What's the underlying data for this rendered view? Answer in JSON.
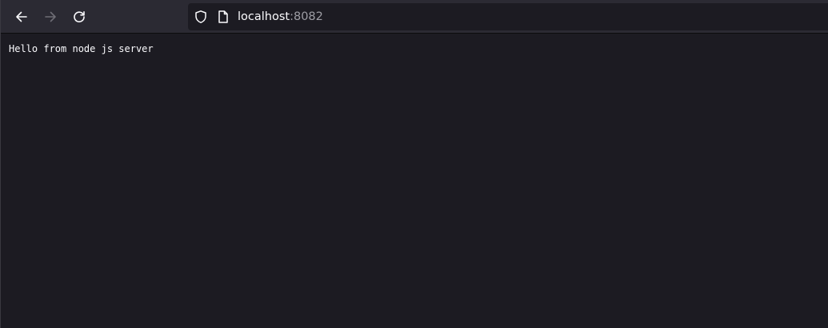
{
  "toolbar": {
    "back_icon": "arrow-left-icon",
    "forward_icon": "arrow-right-icon",
    "reload_icon": "reload-icon"
  },
  "urlbar": {
    "security_icon": "shield-icon",
    "page_icon": "page-icon",
    "host": "localhost",
    "port": ":8082"
  },
  "page": {
    "body_text": "Hello from node js server"
  },
  "colors": {
    "toolbar_bg": "#2b2a33",
    "content_bg": "#1c1b22",
    "text": "#fbfbfe",
    "muted_text": "#9e9ea5"
  }
}
